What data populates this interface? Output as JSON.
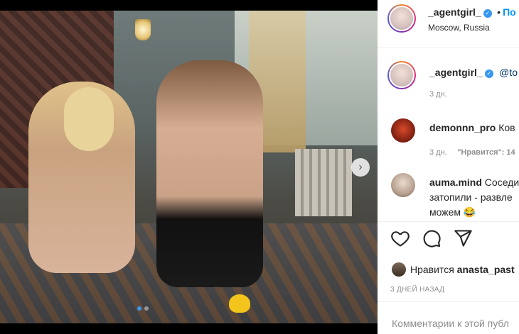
{
  "post": {
    "author": "_agentgirl_",
    "location": "Moscow, Russia",
    "follow_label": "По",
    "photo_alt": "Post photo",
    "carousel": {
      "slides": 2,
      "current": 1
    }
  },
  "caption": {
    "user": "_agentgirl_",
    "mention": "@to",
    "time": "3 дн."
  },
  "comments": [
    {
      "user": "demonnn_pro",
      "text": "Ков",
      "time": "3 дн.",
      "likes_label": "\"Нравится\": 14"
    },
    {
      "user": "auma.mind",
      "text_line1": "Соседи",
      "text_line2": "затопили - развле",
      "text_line3": "можем 😂"
    }
  ],
  "footer": {
    "likes_prefix": "Нравится",
    "likes_user": "anasta_past",
    "date": "3 ДНЕЙ НАЗАД",
    "comment_placeholder": "Комментарии к этой публ"
  },
  "icons": {
    "like": "heart-icon",
    "comment": "speech-bubble-icon",
    "share": "paper-plane-icon",
    "verified": "verified-badge-icon",
    "next": "chevron-right-icon"
  },
  "colors": {
    "verified": "#3897f0",
    "link": "#0095f6",
    "muted": "#8e8e8e",
    "text": "#262626"
  }
}
